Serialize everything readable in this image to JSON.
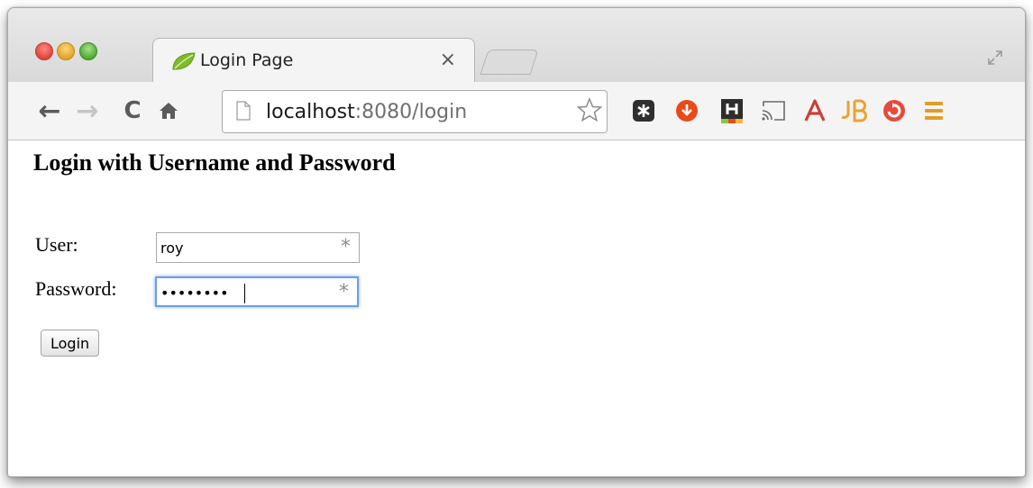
{
  "browser": {
    "tab": {
      "title": "Login Page",
      "close_glyph": "×",
      "favicon": "spring-leaf-icon"
    },
    "nav": {
      "back": "←",
      "forward": "→",
      "reload": "C",
      "home": "home-icon"
    },
    "address": {
      "host": "localhost",
      "rest": ":8080/login"
    },
    "extensions": [
      "extension-puzzle-icon",
      "download-icon",
      "h-extension-icon",
      "cast-icon",
      "font-a-icon",
      "jb-icon",
      "feedly-icon",
      "menu-icon"
    ]
  },
  "page": {
    "heading": "Login with Username and Password",
    "user_label": "User:",
    "user_value": "roy",
    "password_label": "Password:",
    "password_value": "secretpw",
    "required_glyph": "*",
    "submit_label": "Login"
  },
  "colors": {
    "traffic_red": "#e0443e",
    "traffic_yellow": "#e0a32a",
    "traffic_green": "#4faa32",
    "focus_ring": "#6d9ce8",
    "download_ext": "#e84a1a",
    "font_a_ext": "#c8413a",
    "jb_ext": "#e8a432",
    "feedly_ext": "#e64a3a",
    "menu": "#e39d26"
  }
}
